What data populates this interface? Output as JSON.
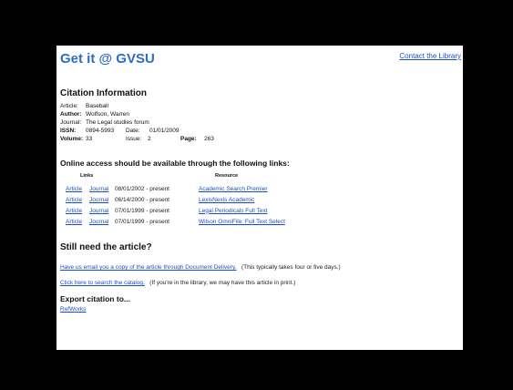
{
  "header": {
    "brand": "Get it @ GVSU",
    "contact_link": "Contact the Library"
  },
  "citation": {
    "heading": "Citation Information",
    "article_label": "Article:",
    "article_value": "Baseball",
    "author_label": "Author:",
    "author_value": "Wolfson, Warren",
    "journal_label": "Journal:",
    "journal_value": "The Legal studies forum",
    "issn_label": "ISSN:",
    "issn_value": "0894-5993",
    "date_label": "Date:",
    "date_value": "01/01/2009",
    "volume_label": "Volume:",
    "volume_value": "33",
    "issue_label": "Issue:",
    "issue_value": "2",
    "page_label": "Page:",
    "page_value": "263"
  },
  "online": {
    "heading": "Online access should be available through the following links:",
    "col_links": "Links",
    "col_resource": "Resource",
    "rows": [
      {
        "article": "Article",
        "journal": "Journal",
        "range": "08/01/2002 - present",
        "resource": "Academic Search Premier"
      },
      {
        "article": "Article",
        "journal": "Journal",
        "range": "06/14/2000 - present",
        "resource": "LexisNexis Academic"
      },
      {
        "article": "Article",
        "journal": "Journal",
        "range": "07/01/1999 - present",
        "resource": "Legal Periodicals Full Text"
      },
      {
        "article": "Article",
        "journal": "Journal",
        "range": "07/01/1999 - present",
        "resource": "Wilson OmniFile: Full Text Select"
      }
    ]
  },
  "still_need": {
    "heading": "Still need the article?",
    "delivery_link": "Have us email you a copy of the article through Document Delivery.",
    "delivery_note": "(This typically takes four or five days.)",
    "catalog_link": "Click here to search the catalog.",
    "catalog_note": "(If you're in the library, we may have this article in print.)"
  },
  "export": {
    "heading": "Export citation to...",
    "refworks": "RefWorks"
  }
}
